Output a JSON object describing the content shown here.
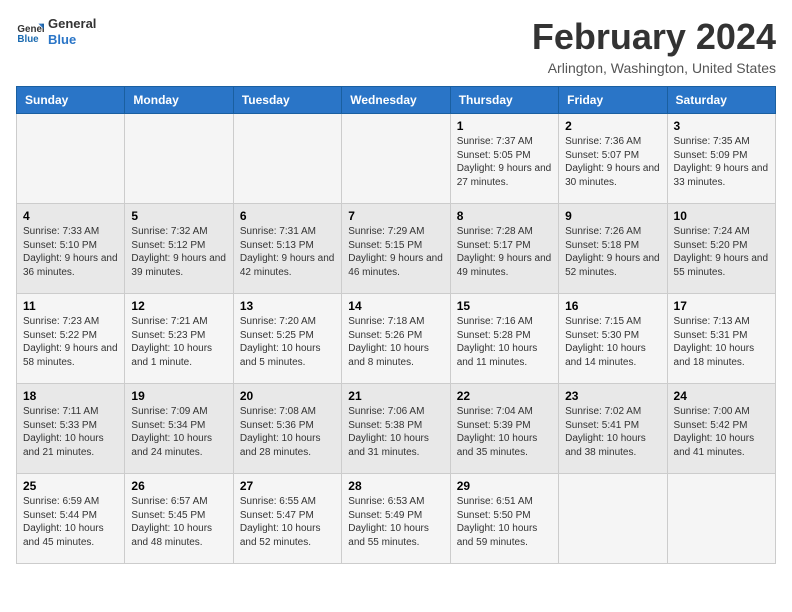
{
  "logo": {
    "line1": "General",
    "line2": "Blue"
  },
  "title": "February 2024",
  "location": "Arlington, Washington, United States",
  "days_of_week": [
    "Sunday",
    "Monday",
    "Tuesday",
    "Wednesday",
    "Thursday",
    "Friday",
    "Saturday"
  ],
  "weeks": [
    [
      {
        "day": "",
        "info": ""
      },
      {
        "day": "",
        "info": ""
      },
      {
        "day": "",
        "info": ""
      },
      {
        "day": "",
        "info": ""
      },
      {
        "day": "1",
        "info": "Sunrise: 7:37 AM\nSunset: 5:05 PM\nDaylight: 9 hours and 27 minutes."
      },
      {
        "day": "2",
        "info": "Sunrise: 7:36 AM\nSunset: 5:07 PM\nDaylight: 9 hours and 30 minutes."
      },
      {
        "day": "3",
        "info": "Sunrise: 7:35 AM\nSunset: 5:09 PM\nDaylight: 9 hours and 33 minutes."
      }
    ],
    [
      {
        "day": "4",
        "info": "Sunrise: 7:33 AM\nSunset: 5:10 PM\nDaylight: 9 hours and 36 minutes."
      },
      {
        "day": "5",
        "info": "Sunrise: 7:32 AM\nSunset: 5:12 PM\nDaylight: 9 hours and 39 minutes."
      },
      {
        "day": "6",
        "info": "Sunrise: 7:31 AM\nSunset: 5:13 PM\nDaylight: 9 hours and 42 minutes."
      },
      {
        "day": "7",
        "info": "Sunrise: 7:29 AM\nSunset: 5:15 PM\nDaylight: 9 hours and 46 minutes."
      },
      {
        "day": "8",
        "info": "Sunrise: 7:28 AM\nSunset: 5:17 PM\nDaylight: 9 hours and 49 minutes."
      },
      {
        "day": "9",
        "info": "Sunrise: 7:26 AM\nSunset: 5:18 PM\nDaylight: 9 hours and 52 minutes."
      },
      {
        "day": "10",
        "info": "Sunrise: 7:24 AM\nSunset: 5:20 PM\nDaylight: 9 hours and 55 minutes."
      }
    ],
    [
      {
        "day": "11",
        "info": "Sunrise: 7:23 AM\nSunset: 5:22 PM\nDaylight: 9 hours and 58 minutes."
      },
      {
        "day": "12",
        "info": "Sunrise: 7:21 AM\nSunset: 5:23 PM\nDaylight: 10 hours and 1 minute."
      },
      {
        "day": "13",
        "info": "Sunrise: 7:20 AM\nSunset: 5:25 PM\nDaylight: 10 hours and 5 minutes."
      },
      {
        "day": "14",
        "info": "Sunrise: 7:18 AM\nSunset: 5:26 PM\nDaylight: 10 hours and 8 minutes."
      },
      {
        "day": "15",
        "info": "Sunrise: 7:16 AM\nSunset: 5:28 PM\nDaylight: 10 hours and 11 minutes."
      },
      {
        "day": "16",
        "info": "Sunrise: 7:15 AM\nSunset: 5:30 PM\nDaylight: 10 hours and 14 minutes."
      },
      {
        "day": "17",
        "info": "Sunrise: 7:13 AM\nSunset: 5:31 PM\nDaylight: 10 hours and 18 minutes."
      }
    ],
    [
      {
        "day": "18",
        "info": "Sunrise: 7:11 AM\nSunset: 5:33 PM\nDaylight: 10 hours and 21 minutes."
      },
      {
        "day": "19",
        "info": "Sunrise: 7:09 AM\nSunset: 5:34 PM\nDaylight: 10 hours and 24 minutes."
      },
      {
        "day": "20",
        "info": "Sunrise: 7:08 AM\nSunset: 5:36 PM\nDaylight: 10 hours and 28 minutes."
      },
      {
        "day": "21",
        "info": "Sunrise: 7:06 AM\nSunset: 5:38 PM\nDaylight: 10 hours and 31 minutes."
      },
      {
        "day": "22",
        "info": "Sunrise: 7:04 AM\nSunset: 5:39 PM\nDaylight: 10 hours and 35 minutes."
      },
      {
        "day": "23",
        "info": "Sunrise: 7:02 AM\nSunset: 5:41 PM\nDaylight: 10 hours and 38 minutes."
      },
      {
        "day": "24",
        "info": "Sunrise: 7:00 AM\nSunset: 5:42 PM\nDaylight: 10 hours and 41 minutes."
      }
    ],
    [
      {
        "day": "25",
        "info": "Sunrise: 6:59 AM\nSunset: 5:44 PM\nDaylight: 10 hours and 45 minutes."
      },
      {
        "day": "26",
        "info": "Sunrise: 6:57 AM\nSunset: 5:45 PM\nDaylight: 10 hours and 48 minutes."
      },
      {
        "day": "27",
        "info": "Sunrise: 6:55 AM\nSunset: 5:47 PM\nDaylight: 10 hours and 52 minutes."
      },
      {
        "day": "28",
        "info": "Sunrise: 6:53 AM\nSunset: 5:49 PM\nDaylight: 10 hours and 55 minutes."
      },
      {
        "day": "29",
        "info": "Sunrise: 6:51 AM\nSunset: 5:50 PM\nDaylight: 10 hours and 59 minutes."
      },
      {
        "day": "",
        "info": ""
      },
      {
        "day": "",
        "info": ""
      }
    ]
  ]
}
